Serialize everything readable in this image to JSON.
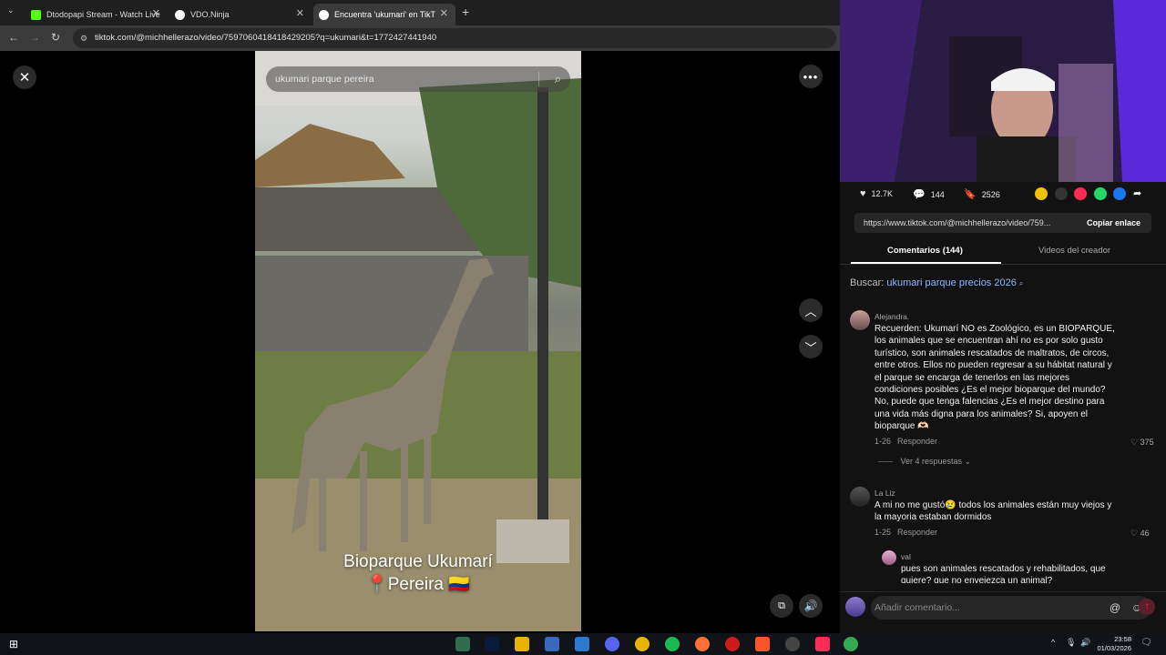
{
  "browser": {
    "tabs": [
      {
        "label": "Dtodopapi Stream - Watch Live",
        "color": "#53fc18"
      },
      {
        "label": "VDO.Ninja",
        "color": "#ffffff"
      },
      {
        "label": "Encuentra 'ukumari' en TikT",
        "color": "#ffffff"
      }
    ],
    "url": "tiktok.com/@michhellerazo/video/7597060418418429205?q=ukumari&t=1772427441940"
  },
  "video": {
    "search_placeholder": "ukumari parque pereira",
    "caption_line1": "Bioparque Ukumarí",
    "caption_line2": "📍Pereira 🇨🇴"
  },
  "actions": {
    "likes": "12.7K",
    "comments": "144",
    "saves": "2526"
  },
  "share": {
    "link": "https://www.tiktok.com/@michhellerazo/video/759...",
    "copy_label": "Copiar enlace"
  },
  "tabs": {
    "comments": "Comentarios (144)",
    "creator": "Videos del creador"
  },
  "search_suggest": {
    "prefix": "Buscar:",
    "query": "ukumari parque precios 2026"
  },
  "comments": [
    {
      "user": "Alejandra.",
      "lines": [
        "Recuerden: Ukumarí NO es Zoológico, es un BIOPARQUE,",
        "los animales que se encuentran ahí no es por solo gusto",
        "turístico, son animales rescatados de maltratos, de circos,",
        "entre otros. Ellos no pueden regresar a su hábitat natural y",
        "el parque se encarga de tenerlos en las mejores",
        "condiciones posibles ¿Es el mejor bioparque del mundo?",
        "No, puede que tenga falencias ¿Es el mejor destino para",
        "una vida más digna para los animales? Si, apoyen el",
        "bioparque 🫶🏻"
      ],
      "date": "1-26",
      "reply": "Responder",
      "likes": "375",
      "view_replies": "Ver 4 respuestas"
    },
    {
      "user": "La Liz",
      "lines": [
        "A mi no me gustó😢 todos los animales están muy viejos y",
        "la mayoria estaban dormidos"
      ],
      "date": "1-25",
      "reply": "Responder",
      "likes": "46"
    },
    {
      "user": "val",
      "lines": [
        "pues son animales rescatados y rehabilitados, que",
        "quiere? que no envejezca un animal?"
      ]
    }
  ],
  "comment_input_placeholder": "Añadir comentario...",
  "taskbar": {
    "time": "23:58",
    "date": "01/03/2026"
  }
}
